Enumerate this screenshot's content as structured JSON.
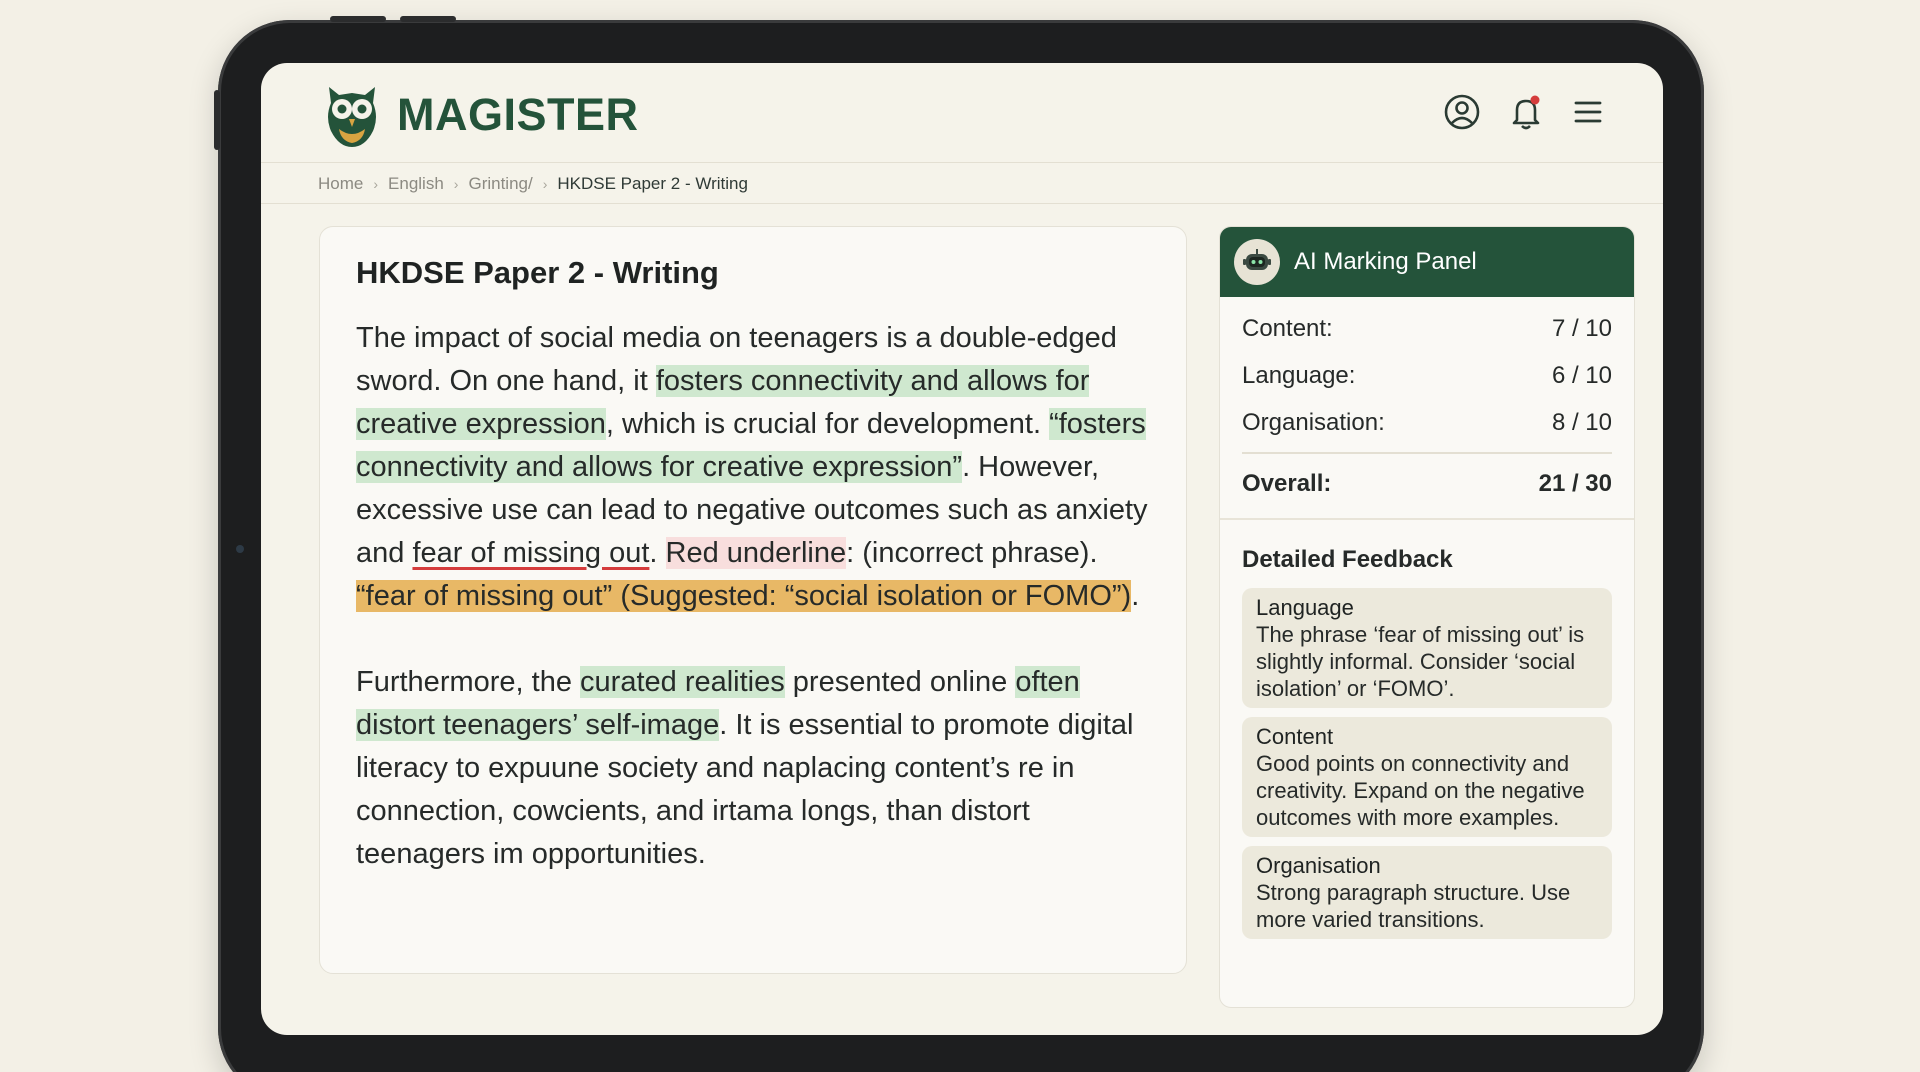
{
  "app": {
    "brand": "MAGISTER"
  },
  "breadcrumb": [
    "Home",
    "English",
    "Grinting/",
    "HKDSE Paper 2 - Writing"
  ],
  "essay": {
    "title": "HKDSE Paper 2 - Writing",
    "p1": [
      {
        "t": "The impact of social media on teenagers is a double-edged sword. On one hand, it ",
        "s": ""
      },
      {
        "t": "fosters connectivity and allows for creative expression",
        "s": "green"
      },
      {
        "t": ", which is crucial for development. ",
        "s": ""
      },
      {
        "t": "“fosters connectivity and allows for creative expression”",
        "s": "green"
      },
      {
        "t": ". However, excessive use can lead to negative outcomes such as anxiety and ",
        "s": ""
      },
      {
        "t": "fear of missing out",
        "s": "underline"
      },
      {
        "t": ". ",
        "s": ""
      },
      {
        "t": "Red underline",
        "s": "pink"
      },
      {
        "t": ": (incorrect phrase). ",
        "s": ""
      },
      {
        "t": "“fear of missing out” (Suggested: “social isolation or FOMO”)",
        "s": "orange"
      },
      {
        "t": ".",
        "s": ""
      }
    ],
    "p2": [
      {
        "t": "Furthermore, the ",
        "s": ""
      },
      {
        "t": "curated realities",
        "s": "green"
      },
      {
        "t": " presented online ",
        "s": ""
      },
      {
        "t": "often distort teenagers’ self-image",
        "s": "green"
      },
      {
        "t": ". It is essential to promote digital literacy to expuune society and naplacing content’s re in connection, cowcients, and irtama longs, than distort teenagers im opportunities.",
        "s": ""
      }
    ]
  },
  "panel": {
    "title": "AI Marking Panel",
    "scores": [
      {
        "label": "Content:",
        "value": "7 / 10"
      },
      {
        "label": "Language:",
        "value": "6 / 10"
      },
      {
        "label": "Organisation:",
        "value": "8 / 10"
      }
    ],
    "overall": {
      "label": "Overall:",
      "value": "21 / 30"
    },
    "feedback_title": "Detailed Feedback",
    "feedback": [
      {
        "heading": "Language",
        "text": "The phrase ‘fear of missing out’ is slightly informal. Consider ‘social isolation’ or ‘FOMO’."
      },
      {
        "heading": "Content",
        "text": "Good points on connectivity and creativity. Expand on the negative outcomes with more examples."
      },
      {
        "heading": "Organisation",
        "text": "Strong paragraph structure. Use more varied transitions."
      }
    ]
  },
  "colors": {
    "brand_green": "#24533a",
    "highlight_green": "#cfe8cf",
    "highlight_pink": "#f8dedd",
    "highlight_orange": "#e8b866",
    "error_red": "#d53c3c"
  },
  "icons": [
    "owl-logo-icon",
    "user-circle-icon",
    "bell-icon",
    "menu-icon",
    "robot-icon",
    "chevron-right-icon"
  ]
}
